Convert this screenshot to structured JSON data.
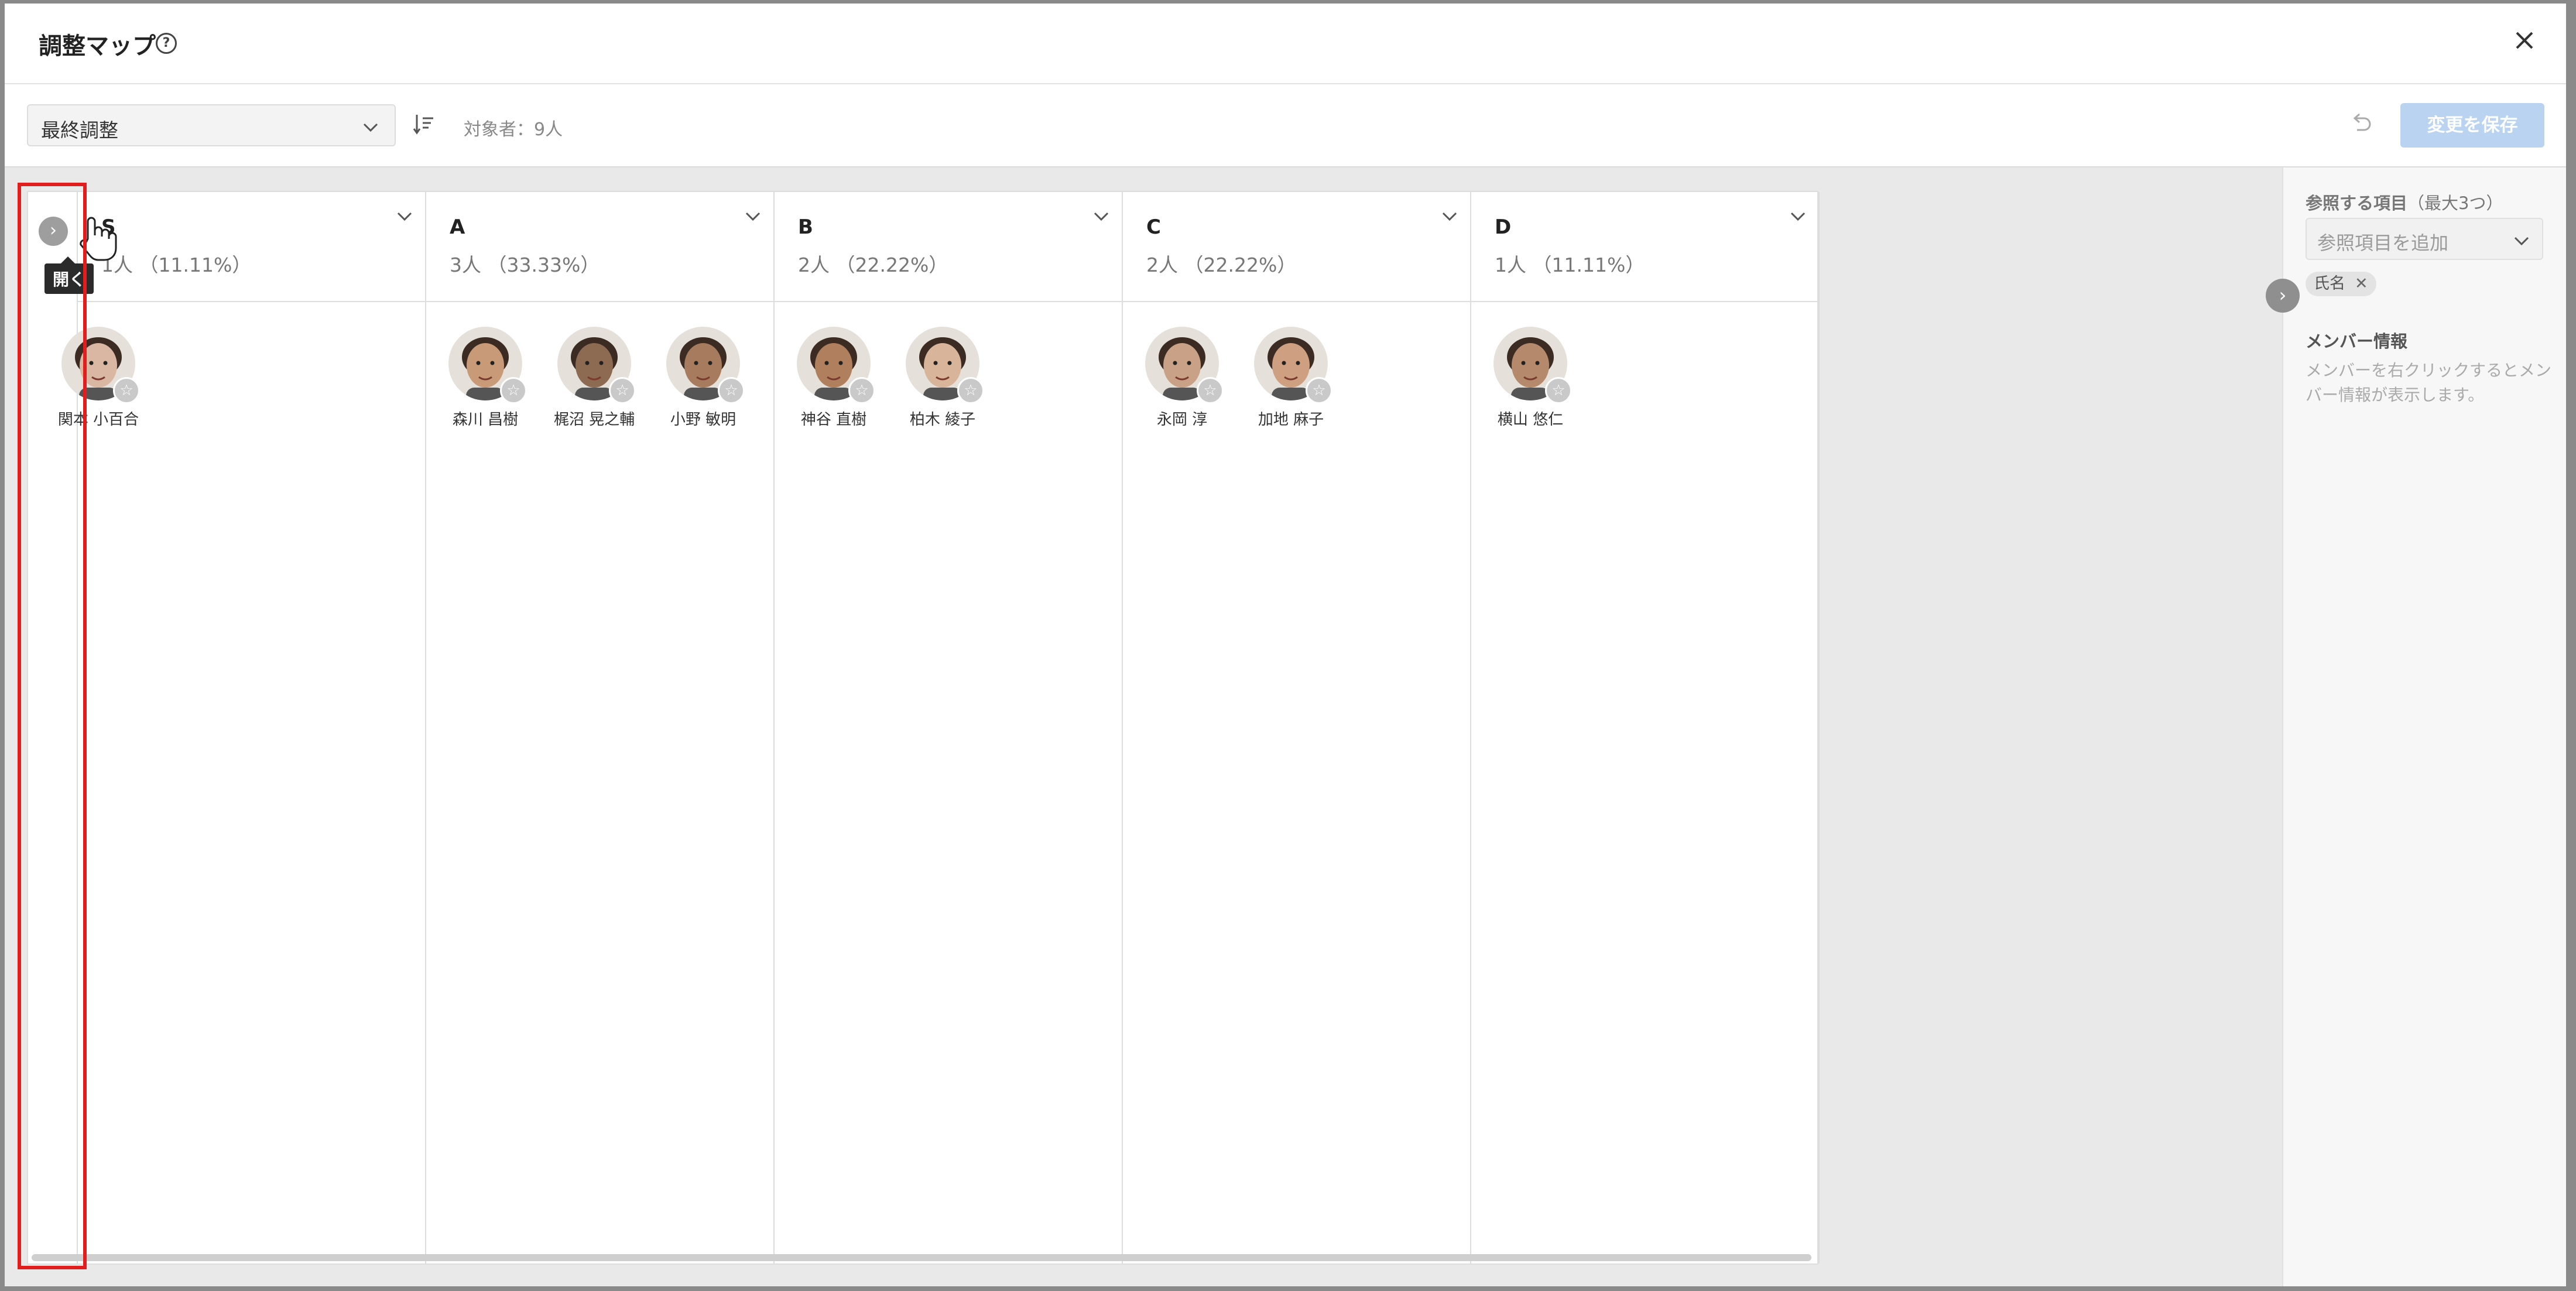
{
  "modal": {
    "title": "調整マップ"
  },
  "toolbar": {
    "select_value": "最終調整",
    "target_count": "対象者：9人",
    "save_label": "変更を保存"
  },
  "board": {
    "tooltip": "開く",
    "columns": [
      {
        "grade": "S",
        "count": "1人 （11.11%）",
        "members": [
          {
            "name": "関本 小百合",
            "avatar_color": "#d9b7a3"
          }
        ]
      },
      {
        "grade": "A",
        "count": "3人 （33.33%）",
        "members": [
          {
            "name": "森川 昌樹",
            "avatar_color": "#c89a77"
          },
          {
            "name": "梶沼 晃之輔",
            "avatar_color": "#8d6a52"
          },
          {
            "name": "小野 敏明",
            "avatar_color": "#a77c5e"
          }
        ]
      },
      {
        "grade": "B",
        "count": "2人 （22.22%）",
        "members": [
          {
            "name": "神谷 直樹",
            "avatar_color": "#b07f5d"
          },
          {
            "name": "柏木 綾子",
            "avatar_color": "#d8b49a"
          }
        ]
      },
      {
        "grade": "C",
        "count": "2人 （22.22%）",
        "members": [
          {
            "name": "永岡 淳",
            "avatar_color": "#c8a187"
          },
          {
            "name": "加地 麻子",
            "avatar_color": "#cf9f81"
          }
        ]
      },
      {
        "grade": "D",
        "count": "1人 （11.11%）",
        "members": [
          {
            "name": "横山 悠仁",
            "avatar_color": "#b58a6c"
          }
        ]
      }
    ]
  },
  "panel": {
    "ref_label": "参照する項目",
    "ref_limit": "（最大3つ）",
    "add_placeholder": "参照項目を追加",
    "chip_label": "氏名",
    "chip_remove": "✕",
    "member_title": "メンバー情報",
    "member_desc": "メンバーを右クリックするとメンバー情報が表示します。"
  },
  "colors": {
    "highlight": "#e21d1d",
    "save_button": "#b9d3f1"
  }
}
